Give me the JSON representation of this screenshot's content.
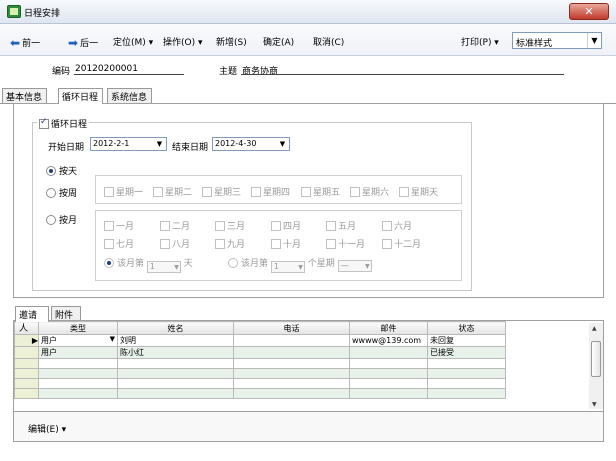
{
  "window": {
    "title": "日程安排",
    "close_label": "✕"
  },
  "toolbar": {
    "prev": "前一",
    "next": "后一",
    "locate": "定位(M) ▾",
    "operate": "操作(O) ▾",
    "add": "新增(S)",
    "ok": "确定(A)",
    "cancel": "取消(C)",
    "print": "打印(P) ▾",
    "style_value": "标准样式"
  },
  "header": {
    "code_label": "编码",
    "code_value": "20120200001",
    "subject_label": "主题",
    "subject_value": "商务协商"
  },
  "tabs": [
    {
      "label": "基本信息"
    },
    {
      "label": "循环日程"
    },
    {
      "label": "系统信息"
    }
  ],
  "recurrence": {
    "group_label": "循环日程",
    "start_label": "开始日期",
    "start_value": "2012-2-1",
    "end_label": "结束日期",
    "end_value": "2012-4-30",
    "by_day": "按天",
    "by_week": "按周",
    "by_month": "按月",
    "weekdays": [
      "星期一",
      "星期二",
      "星期三",
      "星期四",
      "星期五",
      "星期六",
      "星期天"
    ],
    "months": [
      "一月",
      "二月",
      "三月",
      "四月",
      "五月",
      "六月",
      "七月",
      "八月",
      "九月",
      "十月",
      "十一月",
      "十二月"
    ],
    "month_nth_prefix": "该月第",
    "month_nth_value": "1",
    "month_nth_suffix": "天",
    "month_week_prefix": "该月第",
    "month_week_value": "1",
    "month_week_mid": "个星期",
    "month_week_day": "一"
  },
  "bottom_tabs": [
    {
      "label": "邀请人"
    },
    {
      "label": "附件"
    }
  ],
  "grid": {
    "columns": [
      "类型",
      "姓名",
      "电话",
      "邮件",
      "状态"
    ],
    "rows": [
      [
        "用户",
        "刘明",
        "",
        "wwww@139.com",
        "未回复"
      ],
      [
        "用户",
        "陈小红",
        "",
        "",
        "已接受"
      ],
      [
        "",
        "",
        "",
        "",
        ""
      ],
      [
        "",
        "",
        "",
        "",
        ""
      ],
      [
        "",
        "",
        "",
        "",
        ""
      ],
      [
        "",
        "",
        "",
        "",
        ""
      ]
    ]
  },
  "footer": {
    "edit_label": "编辑(E) ▾"
  }
}
